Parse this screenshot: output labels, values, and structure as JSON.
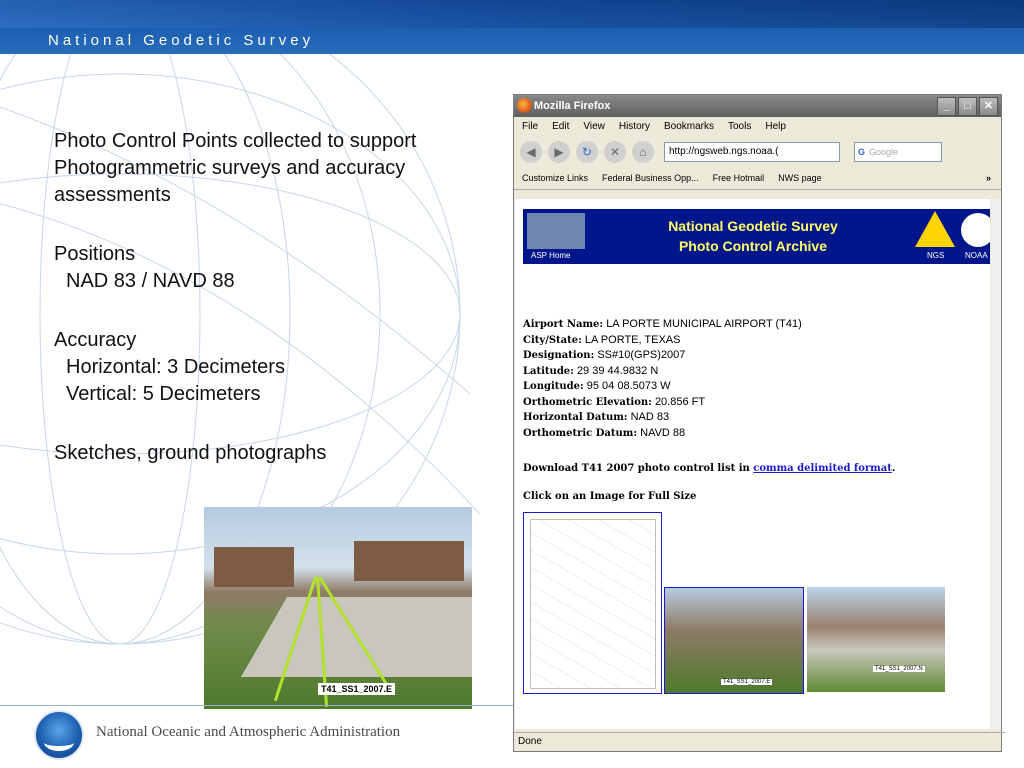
{
  "slide": {
    "header_title": "National Geodetic Survey",
    "footer_org": "National Oceanic and Atmospheric Administration",
    "bullets": [
      "Photo Control Points collected to support Photogrammetric surveys and accuracy assessments",
      "Positions",
      "NAD 83 / NAVD 88",
      "Accuracy",
      "Horizontal: 3 Decimeters",
      "Vertical: 5 Decimeters",
      "Sketches, ground photographs"
    ],
    "photo_tag": "T41_SS1_2007.E"
  },
  "browser": {
    "title": "Mozilla Firefox",
    "menu": [
      "File",
      "Edit",
      "View",
      "History",
      "Bookmarks",
      "Tools",
      "Help"
    ],
    "url": "http://ngsweb.ngs.noaa.(",
    "search_placeholder": "Google",
    "bookmarks": [
      "Customize Links",
      "Federal Business Opp...",
      "Free Hotmail",
      "NWS page"
    ],
    "bookmarks_more": "»",
    "status": "Done"
  },
  "page": {
    "banner_line1": "National Geodetic Survey",
    "banner_line2": "Photo Control Archive",
    "asp_home": "ASP Home",
    "ngs_label": "NGS",
    "noaa_label": "NOAA",
    "fields": [
      {
        "label": "Airport Name:",
        "value": "LA PORTE MUNICIPAL AIRPORT (T41)"
      },
      {
        "label": "City/State:",
        "value": "LA PORTE, TEXAS"
      },
      {
        "label": "Designation:",
        "value": "SS#10(GPS)2007"
      },
      {
        "label": "Latitude:",
        "value": "29 39 44.9832 N"
      },
      {
        "label": "Longitude:",
        "value": "95 04 08.5073 W"
      },
      {
        "label": "Orthometric Elevation:",
        "value": "20.856 FT"
      },
      {
        "label": "Horizontal Datum:",
        "value": "NAD 83"
      },
      {
        "label": "Orthometric Datum:",
        "value": "NAVD 88"
      }
    ],
    "download_prefix": "Download T41 2007 photo control list in",
    "download_link": "comma delimited format",
    "download_suffix": ".",
    "click_text": "Click on an Image for Full Size",
    "thumb2_tag": "T41_SS1_2007.E",
    "thumb3_tag": "T41_SS1_2007.N"
  },
  "colors": {
    "header_blue": "#1d5fb0",
    "banner_navy": "#00168a",
    "banner_text": "#ffff66",
    "link_blue": "#1a1acc"
  },
  "icons": [
    "firefox-icon",
    "back-icon",
    "forward-icon",
    "reload-icon",
    "stop-icon",
    "home-icon",
    "google-icon",
    "page-icon",
    "noaa-logo-icon",
    "ngs-triangle-icon"
  ]
}
